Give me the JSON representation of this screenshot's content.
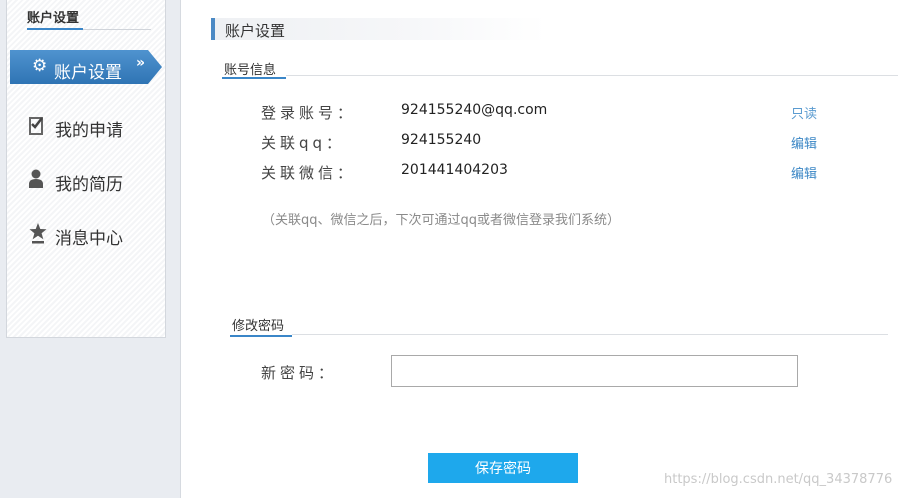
{
  "sidebar": {
    "header": "账户设置",
    "active_item": {
      "label": "账户设置",
      "icon": "gear-icon",
      "chevron": "»"
    },
    "items": [
      {
        "label": "我的申请",
        "icon": "clipboard-check-icon"
      },
      {
        "label": "我的简历",
        "icon": "person-icon"
      },
      {
        "label": "消息中心",
        "icon": "star-icon"
      }
    ]
  },
  "main": {
    "title": "账户设置",
    "account_section": {
      "title": "账号信息",
      "rows": [
        {
          "label": "登录账号：",
          "value": "924155240@qq.com",
          "action": "只读"
        },
        {
          "label": "关联qq：",
          "value": "924155240",
          "action": "编辑"
        },
        {
          "label": "关联微信：",
          "value": "201441404203",
          "action": "编辑"
        }
      ],
      "hint": "（关联qq、微信之后，下次可通过qq或者微信登录我们系统）"
    },
    "password_section": {
      "title": "修改密码",
      "new_password_label": "新密码：",
      "new_password_value": "",
      "save_button": "保存密码"
    }
  },
  "watermark": "https://blog.csdn.net/qq_34378776",
  "colors": {
    "accent": "#3a86c8",
    "button": "#1ea8ec",
    "link": "#3d88c6"
  }
}
